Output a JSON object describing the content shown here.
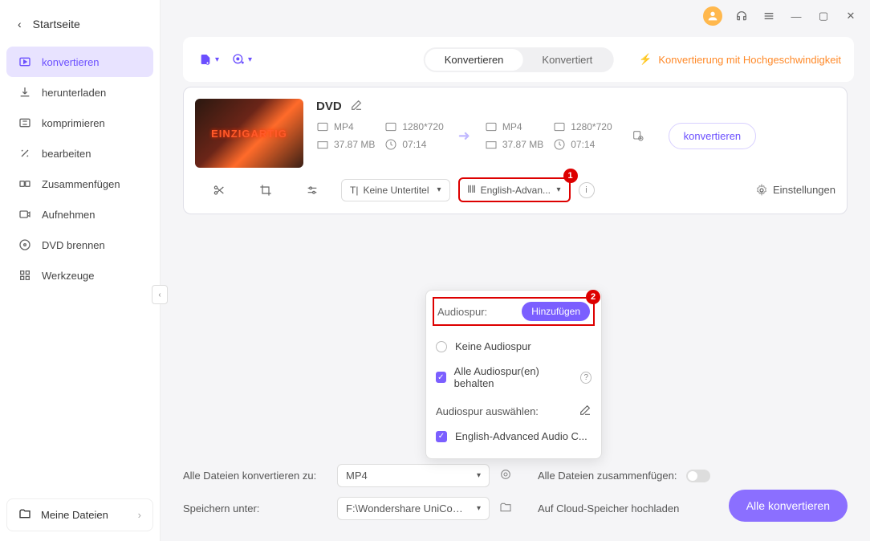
{
  "sidebar": {
    "home": "Startseite",
    "items": [
      "konvertieren",
      "herunterladen",
      "komprimieren",
      "bearbeiten",
      "Zusammenfügen",
      "Aufnehmen",
      "DVD brennen",
      "Werkzeuge"
    ],
    "myfiles": "Meine Dateien"
  },
  "tabs": {
    "converting": "Konvertieren",
    "converted": "Konvertiert"
  },
  "speed_label": "Konvertierung mit Hochgeschwindigkeit",
  "card": {
    "title": "DVD",
    "src": {
      "format": "MP4",
      "res": "1280*720",
      "size": "37.87 MB",
      "dur": "07:14"
    },
    "dst": {
      "format": "MP4",
      "res": "1280*720",
      "size": "37.87 MB",
      "dur": "07:14"
    },
    "convert_btn": "konvertieren",
    "subtitle_dd": "Keine Untertitel",
    "audio_dd": "English-Advan...",
    "settings": "Einstellungen",
    "thumb_text": "EINZIGARTIG"
  },
  "dropdown": {
    "head": "Audiospur:",
    "add": "Hinzufügen",
    "none": "Keine Audiospur",
    "keep": "Alle Audiospur(en) behalten",
    "select": "Audiospur auswählen:",
    "track": "English-Advanced Audio C..."
  },
  "badge1": "1",
  "badge2": "2",
  "bottom": {
    "convert_all_to": "Alle Dateien konvertieren zu:",
    "format": "MP4",
    "merge": "Alle Dateien zusammenfügen:",
    "save_to": "Speichern unter:",
    "path": "F:\\Wondershare UniConverter",
    "cloud": "Auf Cloud-Speicher hochladen",
    "convert_all": "Alle konvertieren"
  }
}
